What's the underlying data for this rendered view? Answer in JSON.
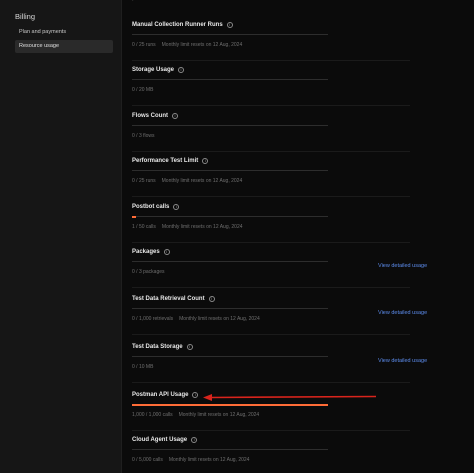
{
  "sidebar": {
    "title": "Billing",
    "items": [
      {
        "label": "Plan and payments",
        "active": false
      },
      {
        "label": "Resource usage",
        "active": true
      }
    ]
  },
  "accent_color": "#ff6c37",
  "link_color": "#5d8dee",
  "sections": [
    {
      "title": "Manual Collection Runner Runs",
      "usage": "0 / 25 runs",
      "reset": "Monthly limit resets on 12 Aug, 2024",
      "fill": 0
    },
    {
      "title": "Storage Usage",
      "usage": "0 / 20 MB",
      "reset": "",
      "fill": 0
    },
    {
      "title": "Flows Count",
      "usage": "0 / 3 flows",
      "reset": "",
      "fill": 0
    },
    {
      "title": "Performance Test Limit",
      "usage": "0 / 25 runs",
      "reset": "Monthly limit resets on 12 Aug, 2024",
      "fill": 0
    },
    {
      "title": "Postbot calls",
      "usage": "1 / 50 calls",
      "reset": "Monthly limit resets on 12 Aug, 2024",
      "fill": 0.02
    },
    {
      "title": "Packages",
      "usage": "0 / 3 packages",
      "reset": "",
      "fill": 0,
      "link": "View detailed usage"
    },
    {
      "title": "Test Data Retrieval Count",
      "usage": "0 / 1,000 retrievals",
      "reset": "Monthly limit resets on 12 Aug, 2024",
      "fill": 0,
      "link": "View detailed usage"
    },
    {
      "title": "Test Data Storage",
      "usage": "0 / 10 MB",
      "reset": "",
      "fill": 0,
      "link": "View detailed usage"
    },
    {
      "title": "Postman API Usage",
      "usage": "1,000 / 1,000 calls",
      "reset": "Monthly limit resets on 12 Aug, 2024",
      "fill": 1
    },
    {
      "title": "Cloud Agent Usage",
      "usage": "0 / 5,000 calls",
      "reset": "Monthly limit resets on 12 Aug, 2024",
      "fill": 0
    }
  ]
}
